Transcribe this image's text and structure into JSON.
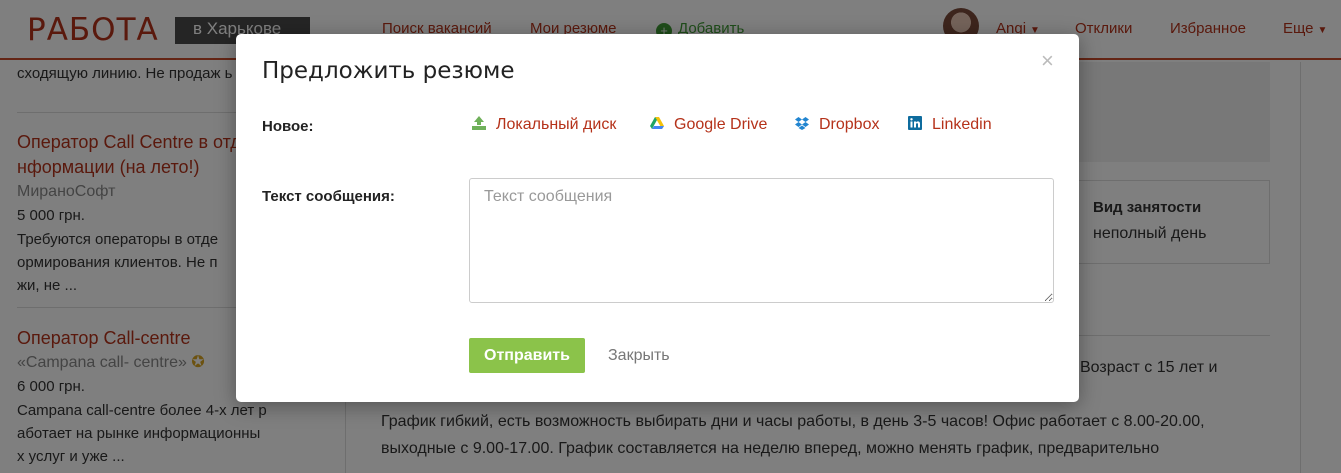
{
  "header": {
    "logo": "РАБОТА",
    "city": "в Харькове",
    "nav": {
      "search": "Поиск вакансий",
      "resumes": "Мои резюме",
      "add": "Добавить",
      "user": "Angi",
      "responses": "Отклики",
      "favorites": "Избранное",
      "more": "Еще"
    },
    "add_icon": "plus-circle-icon"
  },
  "jobs": [
    {
      "desc": "сходящую линию. Не продаж ь ..."
    },
    {
      "title": "Оператор Call Centre в отд нформации (на лето!)",
      "title_line1": "Оператор Call Centre в отд",
      "title_line2": "нформации (на лето!)",
      "company": "МираноСофт",
      "salary": "5 000 грн.",
      "desc_line1": "Требуются операторы в отде",
      "desc_line2": "ормирования клиентов. Не п",
      "desc_line3": "жи, не ..."
    },
    {
      "title": "Оператор Call-centre",
      "company": "«Campana call- centre»",
      "salary": "6 000 грн.",
      "desc_line1": "Campana call-centre более 4-х лет р",
      "desc_line2": "аботает на рынке информационны",
      "desc_line3": "х услуг и уже ..."
    }
  ],
  "vacancy": {
    "employment_label": "Вид занятости",
    "employment_value": "неполный день",
    "age_text": "Возраст с 15 лет и",
    "schedule_line1": "График гибкий, есть возможность выбирать дни и часы работы, в день 3-5 часов! Офис работает с 8.00-20.00,",
    "schedule_line2": "выходные с 9.00-17.00. График составляется на неделю вперед, можно менять график, предварительно"
  },
  "modal": {
    "title": "Предложить резюме",
    "close_symbol": "×",
    "new_label": "Новое:",
    "sources": [
      {
        "label": "Локальный диск",
        "icon": "upload-icon"
      },
      {
        "label": "Google Drive",
        "icon": "google-drive-icon"
      },
      {
        "label": "Dropbox",
        "icon": "dropbox-icon"
      },
      {
        "label": "Linkedin",
        "icon": "linkedin-icon"
      }
    ],
    "message_label": "Текст сообщения:",
    "message_placeholder": "Текст сообщения",
    "message_value": "",
    "send_label": "Отправить",
    "cancel_label": "Закрыть"
  },
  "colors": {
    "brand": "#b5321a",
    "send_button": "#8bc34a"
  }
}
